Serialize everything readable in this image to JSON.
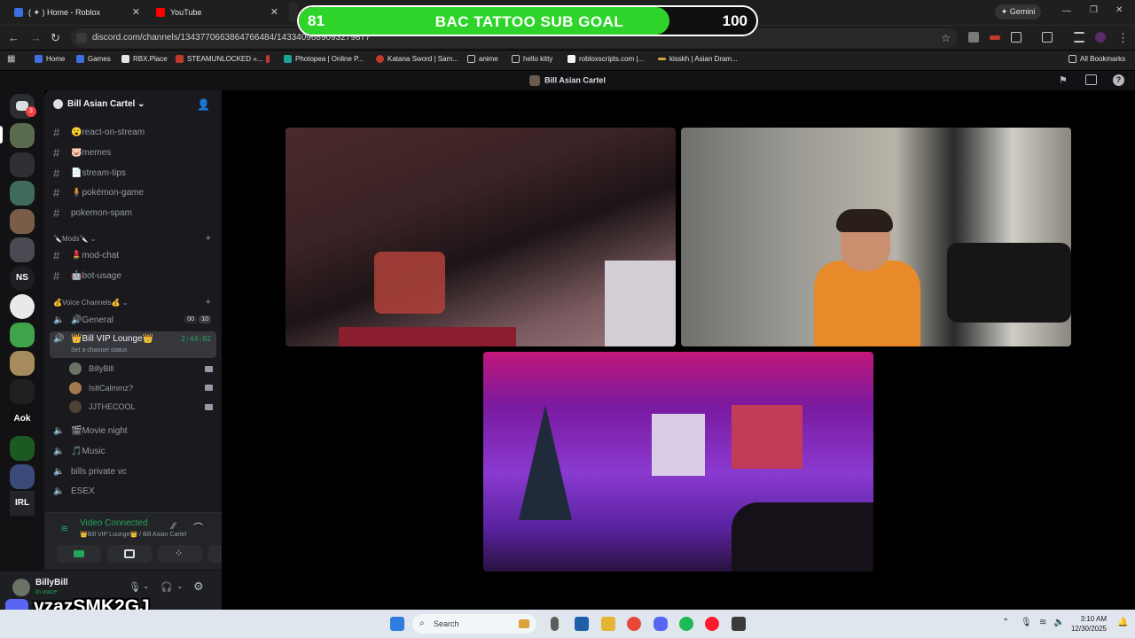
{
  "browser": {
    "tabs": [
      {
        "title": "( ✦ ) Home - Roblox",
        "color": "#3d6fe0"
      },
      {
        "title": "YouTube",
        "color": "#ff0000"
      },
      {
        "title": "",
        "color": "#5865f2"
      }
    ],
    "url": "discord.com/channels/1343770663864766484/1433409689093279877",
    "gemini_label": "Gemini",
    "bookmarks": [
      "Home",
      "Games",
      "RBX.Place",
      "STEAMUNLOCKED »...",
      "Photopea | Online P...",
      "Katana Sword | Sam...",
      "anime",
      "hello kitty",
      "robloxscripts.com |...",
      "kisskh | Asian Dram..."
    ],
    "all_bookmarks": "All Bookmarks"
  },
  "sub_goal": {
    "current": "81",
    "title": "BAC TATTOO SUB GOAL",
    "target": "100",
    "progress": 0.81
  },
  "discord": {
    "top_title": "Bill Asian Cartel",
    "server_name": "Bill Asian Cartel",
    "text_channels": [
      {
        "name": "😮react-on-stream"
      },
      {
        "name": "🐷memes"
      },
      {
        "name": "📄stream-tips"
      },
      {
        "name": "🧍pokémon-game"
      },
      {
        "name": "pokemon-spam"
      }
    ],
    "mods_category": "🔪Mods🔪",
    "mod_channels": [
      {
        "name": "💄mod-chat"
      },
      {
        "name": "🤖bot-usage"
      }
    ],
    "voice_category": "💰Voice Channels💰",
    "voice_channels": {
      "general": "🔊General",
      "general_counts": [
        "00",
        "10"
      ],
      "vip": "👑Bill VIP Lounge👑",
      "vip_timer": "2:44:02",
      "vip_status": "Set a channel status",
      "members": [
        "BillyBill",
        "IsItCalmmz?",
        "JJTHECOOL"
      ],
      "others": [
        "🎬Movie night",
        "🎵Music",
        "bills private vc",
        "ESEX"
      ]
    },
    "guild_labels": [
      "NS",
      "Aok",
      "IRL"
    ],
    "voice_panel": {
      "status": "Video Connected",
      "location": "👑Bill VIP Lounge👑 / Bill Asian Cartel"
    },
    "user": {
      "name": "BillyBill",
      "status": "In voice"
    }
  },
  "watermark": "vzazSMK2GJ",
  "taskbar": {
    "search_placeholder": "Search",
    "time": "3:10 AM",
    "date": "12/30/2025"
  }
}
